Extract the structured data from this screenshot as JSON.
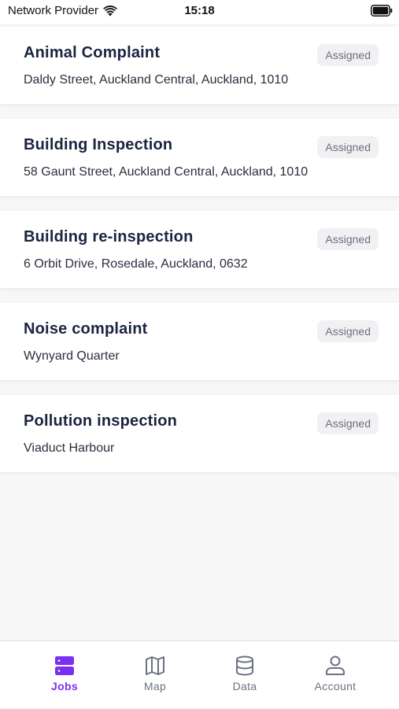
{
  "status_bar": {
    "carrier": "Network Provider",
    "time": "15:18"
  },
  "jobs": [
    {
      "title": "Animal Complaint",
      "address": "Daldy Street, Auckland Central, Auckland, 1010",
      "status": "Assigned"
    },
    {
      "title": "Building Inspection",
      "address": "58 Gaunt Street, Auckland Central, Auckland, 1010",
      "status": "Assigned"
    },
    {
      "title": "Building re-inspection",
      "address": "6 Orbit Drive, Rosedale, Auckland, 0632",
      "status": "Assigned"
    },
    {
      "title": "Noise complaint",
      "address": "Wynyard Quarter",
      "status": "Assigned"
    },
    {
      "title": "Pollution inspection",
      "address": "Viaduct Harbour",
      "status": "Assigned"
    }
  ],
  "tab_bar": {
    "tabs": [
      {
        "label": "Jobs",
        "icon": "jobs-icon",
        "active": true
      },
      {
        "label": "Map",
        "icon": "map-icon",
        "active": false
      },
      {
        "label": "Data",
        "icon": "database-icon",
        "active": false
      },
      {
        "label": "Account",
        "icon": "user-icon",
        "active": false
      }
    ]
  },
  "colors": {
    "accent": "#7a2ff2",
    "inactive": "#6b7280",
    "title": "#1b2440",
    "background": "#f7f7f8"
  }
}
